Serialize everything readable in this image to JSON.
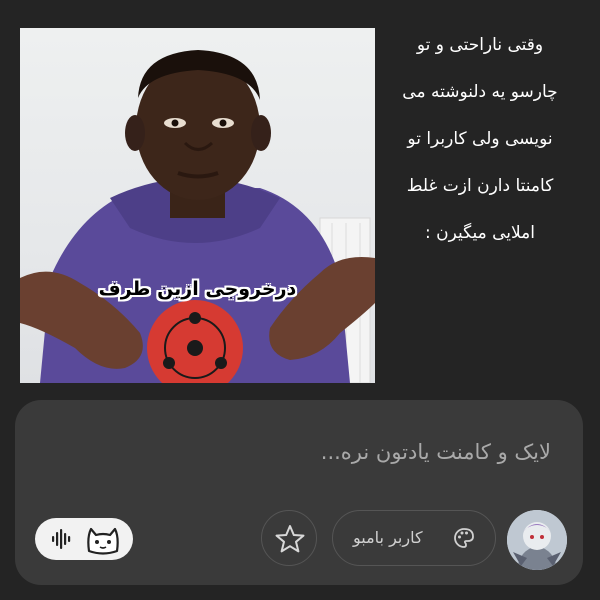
{
  "post": {
    "text_lines": [
      "وقتی ناراحتی و تو",
      "چارسو یه دلنوشته می",
      "نویسی ولی کاربرا تو",
      "کامنتا دارن ازت غلط",
      "املایی میگیرن :"
    ],
    "meme_caption": "درخروجی ازین طرف"
  },
  "composer": {
    "placeholder": "لایک و کامنت یادتون نره...",
    "user_chip_label": "کاربر بامبو"
  },
  "icons": {
    "voice": "waveform-icon",
    "cat": "cat-icon",
    "star": "star-icon",
    "palette": "palette-icon"
  },
  "colors": {
    "background": "#242424",
    "composer": "#3a3a3a",
    "hoodie": "#5a4a9a",
    "sharingan": "#d63a32"
  }
}
